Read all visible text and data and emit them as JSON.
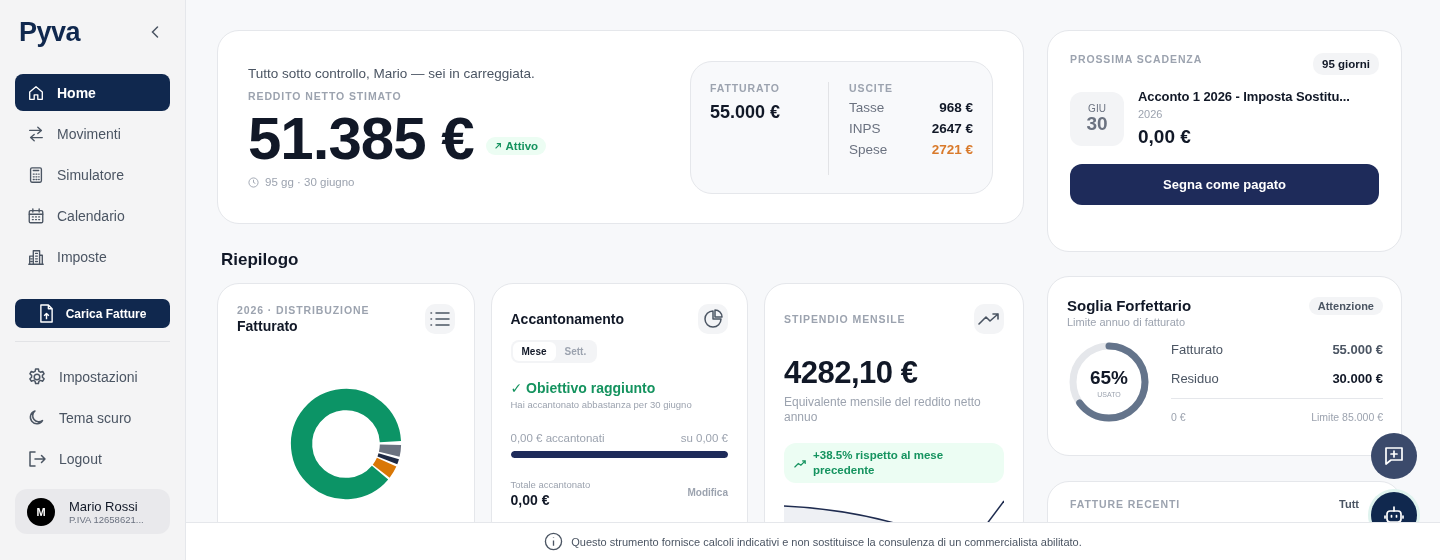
{
  "sidebar": {
    "logo": "Pyva",
    "nav": [
      {
        "label": "Home",
        "selected": true
      },
      {
        "label": "Movimenti",
        "selected": false
      },
      {
        "label": "Simulatore",
        "selected": false
      },
      {
        "label": "Calendario",
        "selected": false
      },
      {
        "label": "Imposte",
        "selected": false
      }
    ],
    "upload_button": "Carica Fatture",
    "settings": [
      {
        "label": "Impostazioni"
      },
      {
        "label": "Tema scuro"
      },
      {
        "label": "Logout"
      }
    ],
    "user": {
      "initial": "M",
      "name": "Mario Rossi",
      "vat": "P.IVA 12658621..."
    }
  },
  "hero": {
    "greeting": "Tutto sotto controllo, Mario — sei in carreggiata.",
    "label": "REDDITO NETTO STIMATO",
    "amount": "51.385 €",
    "status": "Attivo",
    "meta": "95 gg · 30 giugno",
    "revenue": {
      "label": "FATTURATO",
      "value": "55.000 €"
    },
    "expenses": {
      "label": "USCITE",
      "rows": [
        {
          "name": "Tasse",
          "value": "968 €",
          "color": "#111827"
        },
        {
          "name": "INPS",
          "value": "2647 €",
          "color": "#111827"
        },
        {
          "name": "Spese",
          "value": "2721 €",
          "color": "#d97a2b"
        }
      ]
    }
  },
  "section_title": "Riepilogo",
  "distribution": {
    "eyebrow": "2026 · DISTRIBUZIONE",
    "title": "Fatturato"
  },
  "savings": {
    "title": "Accantonamento",
    "tabs": [
      {
        "label": "Mese",
        "selected": true
      },
      {
        "label": "Sett.",
        "selected": false
      }
    ],
    "status": "✓ Obiettivo raggiunto",
    "note": "Hai accantonato abbastanza per 30 giugno",
    "saved": "0,00 € accantonati",
    "target": "su 0,00 €",
    "level": 1,
    "total_label": "Totale accantonato",
    "total": "0,00 €",
    "edit": "Modifica"
  },
  "salary": {
    "label": "STIPENDIO MENSILE",
    "amount": "4282,10 €",
    "description": "Equivalente mensile del reddito netto annuo",
    "trend": "+38.5% rispetto al mese precedente"
  },
  "deadline": {
    "label": "PROSSIMA SCADENZA",
    "days": "95 giorni",
    "month": "GIU",
    "day": "30",
    "title": "Acconto 1 2026 - Imposta Sostitu...",
    "year": "2026",
    "amount": "0,00 €",
    "button": "Segna come pagato"
  },
  "threshold": {
    "title": "Soglia Forfettario",
    "subtitle": "Limite annuo di fatturato",
    "badge": "Attenzione",
    "percent": "65%",
    "caption": "USATO",
    "level": 0.65,
    "rows": [
      {
        "name": "Fatturato",
        "value": "55.000 €"
      },
      {
        "name": "Residuo",
        "value": "30.000 €"
      }
    ],
    "min": "0 €",
    "max": "Limite 85.000 €"
  },
  "recent": {
    "title": "FATTURE RECENTI",
    "link": "Tutt"
  },
  "footer": "Questo strumento fornisce calcoli indicativi e non sostituisce la consulenza di un commercialista abilitato."
}
